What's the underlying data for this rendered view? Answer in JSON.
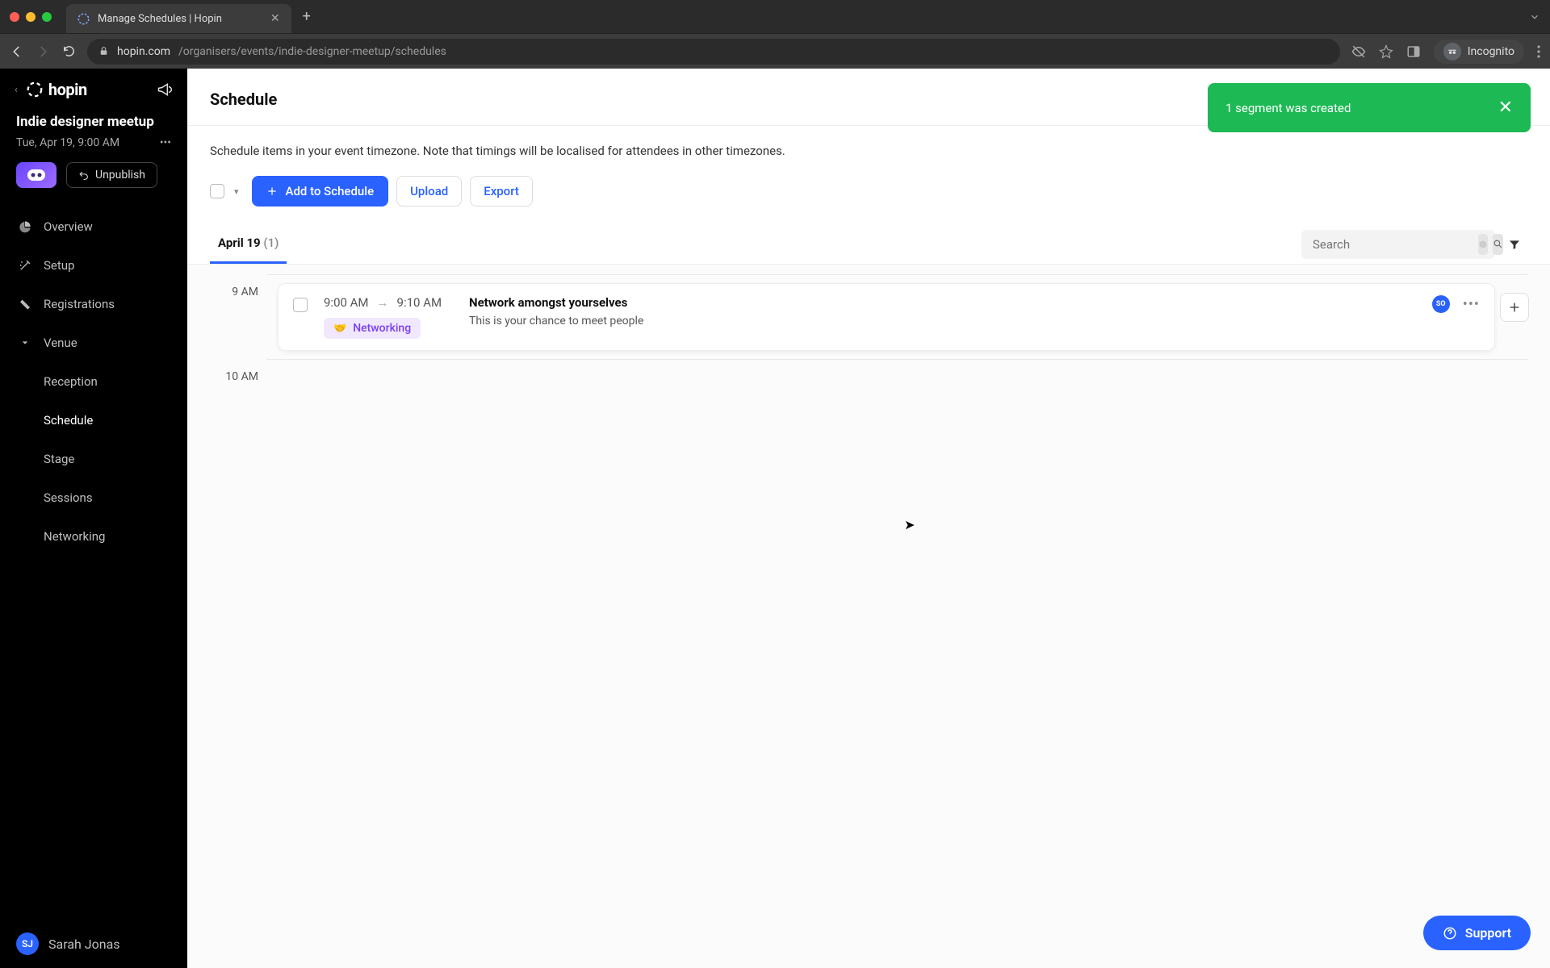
{
  "browser": {
    "tab_title": "Manage Schedules | Hopin",
    "url_host": "hopin.com",
    "url_path": "/organisers/events/indie-designer-meetup/schedules",
    "incognito_label": "Incognito"
  },
  "sidebar": {
    "brand": "hopin",
    "event_title": "Indie designer meetup",
    "event_date": "Tue, Apr 19, 9:00 AM",
    "unpublish_label": "Unpublish",
    "nav": {
      "overview": "Overview",
      "setup": "Setup",
      "registrations": "Registrations",
      "venue": "Venue",
      "reception": "Reception",
      "schedule": "Schedule",
      "stage": "Stage",
      "sessions": "Sessions",
      "networking": "Networking"
    },
    "user_initials": "SJ",
    "user_name": "Sarah Jonas"
  },
  "toast": {
    "message": "1 segment was created"
  },
  "page": {
    "title": "Schedule",
    "helper": "Schedule items in your event timezone. Note that timings will be localised for attendees in other timezones.",
    "add_label": "Add to Schedule",
    "upload_label": "Upload",
    "export_label": "Export",
    "date_tab_label": "April 19",
    "date_tab_count": "(1)",
    "search_placeholder": "Search"
  },
  "timeline": {
    "slot1": "9 AM",
    "slot2": "10 AM",
    "item": {
      "start": "9:00 AM",
      "end": "9:10 AM",
      "tag": "Networking",
      "title": "Network amongst yourselves",
      "desc": "This is your chance to meet people",
      "speaker_initials": "SO"
    }
  },
  "support_label": "Support"
}
